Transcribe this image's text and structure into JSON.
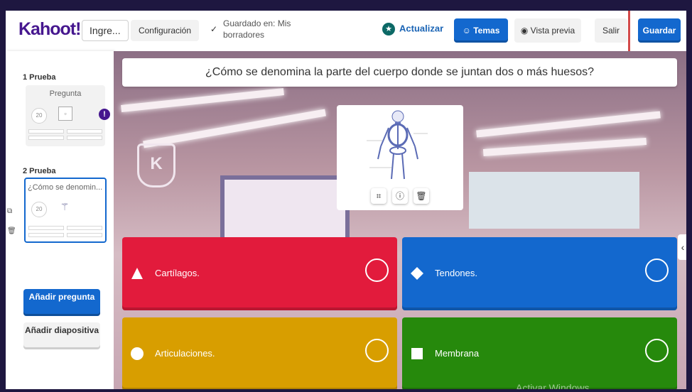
{
  "topbar": {
    "logo": "Kahoot!",
    "title_value": "Ingre...",
    "config_label": "Configuración",
    "saved_text": "Guardado en: Mis borradores",
    "update_label": "Actualizar",
    "themes_label": "Temas",
    "preview_label": "Vista previa",
    "exit_label": "Salir",
    "save_label": "Guardar"
  },
  "sidebar": {
    "slides": [
      {
        "label": "1 Prueba",
        "thumb_title": "Pregunta",
        "timer": "20"
      },
      {
        "label": "2 Prueba",
        "thumb_title": "¿Cómo se denomin...",
        "timer": "20"
      }
    ],
    "add_question_label": "Añadir pregunta",
    "add_slide_label": "Añadir diapositiva"
  },
  "editor": {
    "question": "¿Cómo se denomina la parte del cuerpo donde se juntan dos o más huesos?",
    "answers": [
      {
        "text": "Cartílagos.",
        "color": "#e21b3c",
        "shape": "triangle"
      },
      {
        "text": "Tendones.",
        "color": "#1368ce",
        "shape": "diamond"
      },
      {
        "text": "Articulaciones.",
        "color": "#d89e00",
        "shape": "circle"
      },
      {
        "text": "Membrana",
        "color": "#26890c",
        "shape": "square"
      }
    ],
    "watermark": "Activar Windows"
  },
  "colors": {
    "brand": "#46178f",
    "primary": "#1368ce",
    "highlight_box": "#d34a4a"
  }
}
